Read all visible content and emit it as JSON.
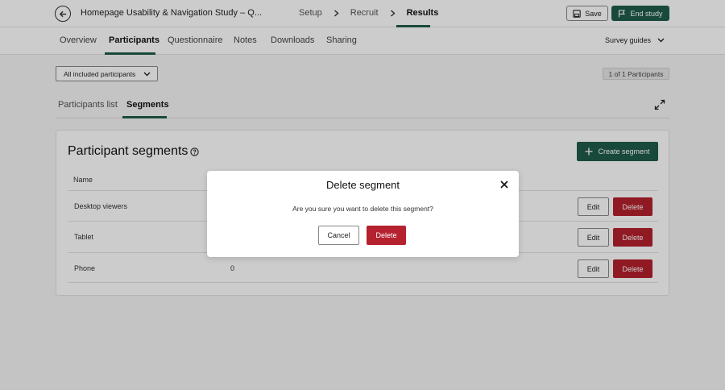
{
  "header": {
    "study_title": "Homepage Usability & Navigation Study – Q...",
    "steps": [
      {
        "label": "Setup"
      },
      {
        "label": "Recruit"
      },
      {
        "label": "Results"
      }
    ],
    "save_label": "Save",
    "end_label": "End study"
  },
  "subnav": {
    "tabs": [
      "Overview",
      "Participants",
      "Questionnaire",
      "Notes",
      "Downloads",
      "Sharing"
    ],
    "guides_label": "Survey guides"
  },
  "filter": {
    "selected": "All included participants",
    "count_text": "1 of 1 Participants"
  },
  "results_tabs": [
    "Participants list",
    "Segments"
  ],
  "segments": {
    "title": "Participant segments",
    "create_label": "Create segment",
    "column_name": "Name",
    "rows": [
      {
        "name": "Desktop viewers",
        "count": "",
        "edit": "Edit",
        "delete": "Delete"
      },
      {
        "name": "Tablet",
        "count": "",
        "edit": "Edit",
        "delete": "Delete"
      },
      {
        "name": "Phone",
        "count": "0",
        "edit": "Edit",
        "delete": "Delete"
      }
    ]
  },
  "modal": {
    "title": "Delete segment",
    "message": "Are you sure you want to delete this segment?",
    "cancel_label": "Cancel",
    "delete_label": "Delete"
  },
  "colors": {
    "accent": "#1f5c4a",
    "danger": "#b5212e"
  }
}
